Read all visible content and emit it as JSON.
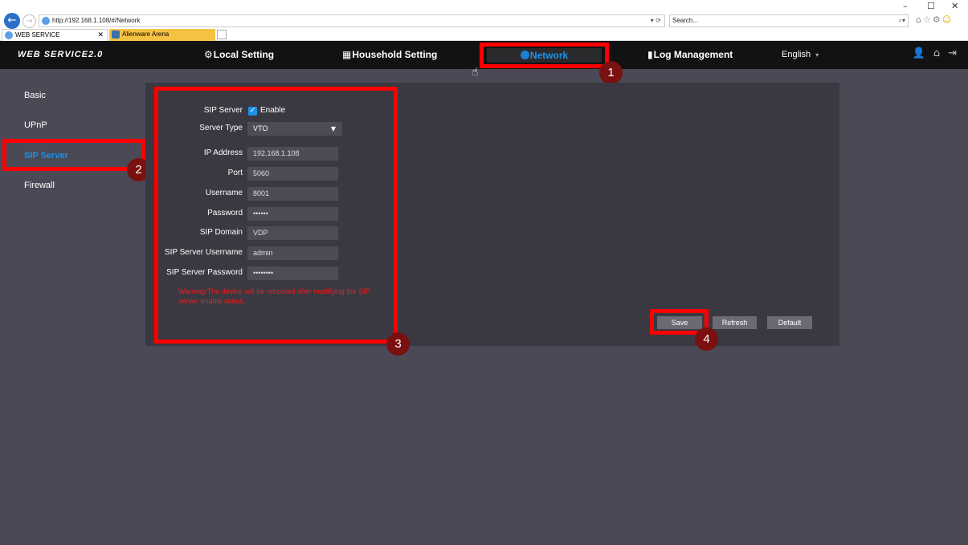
{
  "browser": {
    "window_controls": [
      "–",
      "☐",
      "✕"
    ],
    "url": "http://192.168.1.108/#/Network",
    "url_tools": "▾ ⟳",
    "search_placeholder": "Search...",
    "search_tools": "⌕▾",
    "icons": [
      "home-icon",
      "star-icon",
      "gear-icon",
      "smiley-icon"
    ],
    "tabs": [
      {
        "label": "WEB SERVICE",
        "close": "✕"
      },
      {
        "label": "Alienware Arena"
      }
    ]
  },
  "header": {
    "logo": "WEB SERVICE2.0",
    "nav": {
      "local_setting": "Local Setting",
      "household_setting": "Household Setting",
      "network": "Network",
      "log_management": "Log Management"
    },
    "language": "English",
    "language_caret": "▾",
    "icons": [
      "user-icon",
      "home-icon",
      "logout-icon"
    ]
  },
  "sidebar": {
    "items": [
      "Basic",
      "UPnP",
      "SIP Server",
      "Firewall"
    ],
    "active": "SIP Server"
  },
  "form": {
    "sip_server_label": "SIP Server",
    "enable_label": "Enable",
    "enable_checked": true,
    "server_type_label": "Server Type",
    "server_type_value": "VTO",
    "ip_address_label": "IP Address",
    "ip_address_value": "192.168.1.108",
    "port_label": "Port",
    "port_value": "5060",
    "username_label": "Username",
    "username_value": "8001",
    "password_label": "Password",
    "password_value": "••••••",
    "sip_domain_label": "SIP Domain",
    "sip_domain_value": "VDP",
    "sip_server_username_label": "SIP Server Username",
    "sip_server_username_value": "admin",
    "sip_server_password_label": "SIP Server Password",
    "sip_server_password_value": "••••••••",
    "warning": "Warning:The device will be rebooted after modifying the SIP server enable status."
  },
  "buttons": {
    "save": "Save",
    "refresh": "Refresh",
    "default": "Default"
  },
  "annotations": [
    "1",
    "2",
    "3",
    "4"
  ],
  "colors": {
    "accent": "#1e90e8",
    "highlight": "#ff0000",
    "warning": "#ee1c1c",
    "badge": "#7a1010"
  }
}
